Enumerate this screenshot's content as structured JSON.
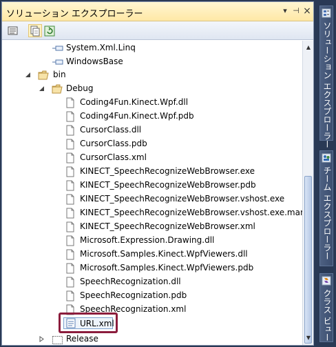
{
  "window": {
    "title": "ソリューション エクスプローラー",
    "dropdown_glyph": "▾",
    "pin_glyph": "⊣",
    "close_glyph": "×"
  },
  "tree": {
    "refs": [
      "System.Xml.Linq",
      "WindowsBase"
    ],
    "bin_label": "bin",
    "debug_label": "Debug",
    "files": [
      "Coding4Fun.Kinect.Wpf.dll",
      "Coding4Fun.Kinect.Wpf.pdb",
      "CursorClass.dll",
      "CursorClass.pdb",
      "CursorClass.xml",
      "KINECT_SpeechRecognizeWebBrowser.exe",
      "KINECT_SpeechRecognizeWebBrowser.pdb",
      "KINECT_SpeechRecognizeWebBrowser.vshost.exe",
      "KINECT_SpeechRecognizeWebBrowser.vshost.exe.manif",
      "KINECT_SpeechRecognizeWebBrowser.xml",
      "Microsoft.Expression.Drawing.dll",
      "Microsoft.Samples.Kinect.WpfViewers.dll",
      "Microsoft.Samples.Kinect.WpfViewers.pdb",
      "SpeechRecognization.dll",
      "SpeechRecognization.pdb",
      "SpeechRecognization.xml"
    ],
    "selected_file": "URL.xml",
    "release_label": "Release"
  },
  "sidebar": {
    "tabs": [
      {
        "label": "ソリューション エクスプローラー"
      },
      {
        "label": "チーム エクスプローラー"
      },
      {
        "label": "クラス ビュー"
      }
    ]
  },
  "colors": {
    "titlebar": "#ffe8a6",
    "frame": "#293955",
    "highlight_box": "#8b1c3c"
  }
}
